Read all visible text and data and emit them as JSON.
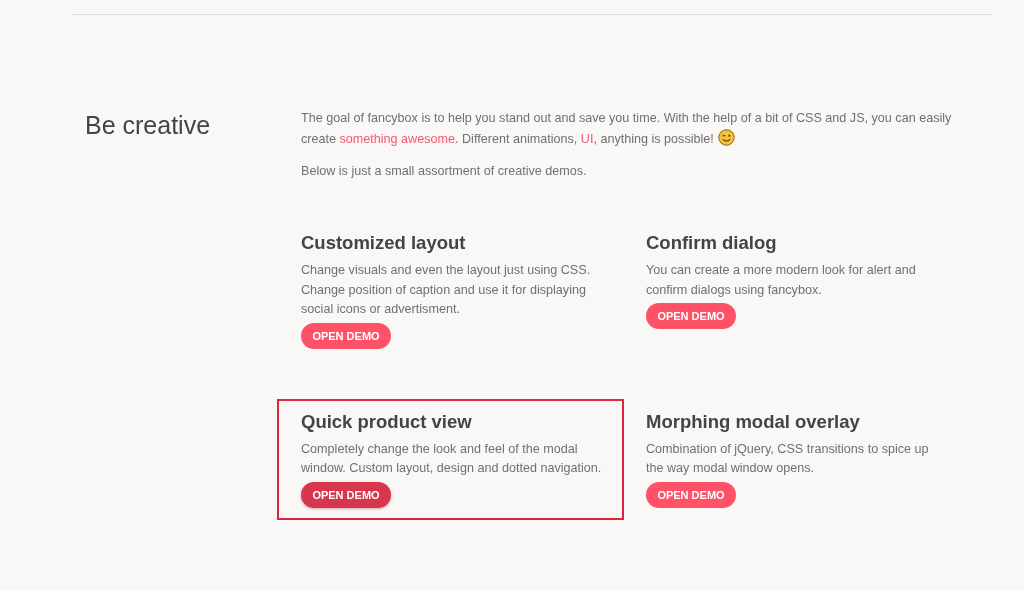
{
  "section": {
    "heading": "Be creative",
    "intro": [
      {
        "kind": "text",
        "text": "The goal of fancybox is to help you stand out and save you time. With the help of a bit of CSS and JS, you can easily create "
      },
      {
        "kind": "link",
        "text": "something awesome"
      },
      {
        "kind": "text",
        "text": ". Different animations, "
      },
      {
        "kind": "link",
        "text": "UI"
      },
      {
        "kind": "text",
        "text": ", anything is possible!"
      },
      {
        "kind": "emoji"
      }
    ],
    "note": "Below is just a small assortment of creative demos.",
    "demos": [
      {
        "title": "Customized layout",
        "description": "Change visuals and even the layout just using CSS. Change position of caption and use it for displaying social icons or advertisment.",
        "button": "OPEN DEMO",
        "highlighted": false,
        "hovered": false
      },
      {
        "title": "Confirm dialog",
        "description": "You can create a more modern look for alert and confirm dialogs using fancybox.",
        "button": "OPEN DEMO",
        "highlighted": false,
        "hovered": false
      },
      {
        "title": "Quick product view",
        "description": "Completely change the look and feel of the modal window. Custom layout, design and dotted navigation.",
        "button": "OPEN DEMO",
        "highlighted": true,
        "hovered": true
      },
      {
        "title": "Morphing modal overlay",
        "description": "Combination of jQuery, CSS transitions to spice up the way modal window opens.",
        "button": "OPEN DEMO",
        "highlighted": false,
        "hovered": false
      }
    ]
  }
}
